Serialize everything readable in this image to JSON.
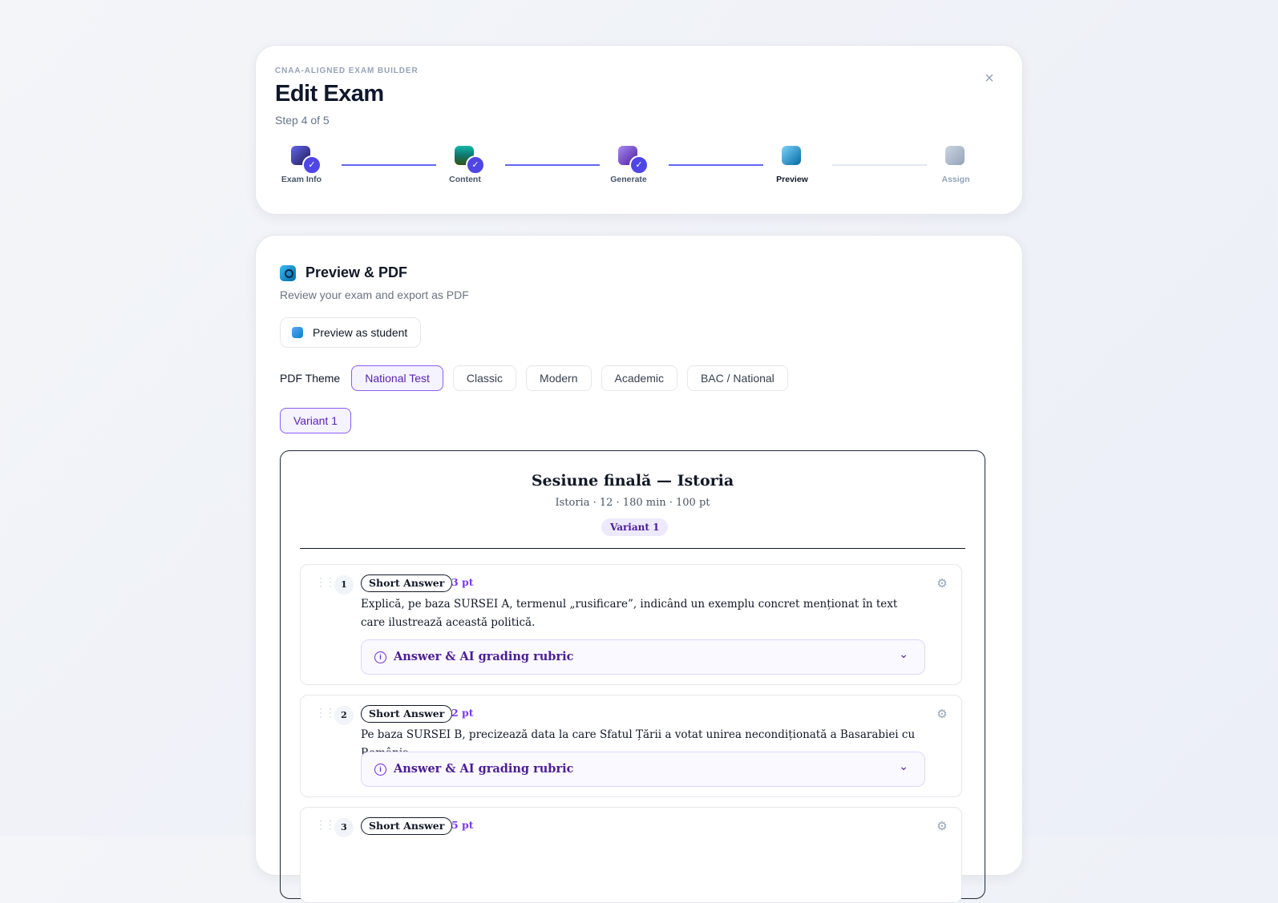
{
  "header": {
    "eyebrow": "CNAA-ALIGNED EXAM BUILDER",
    "title": "Edit Exam",
    "step_count": "Step 4 of 5",
    "close_icon": "×"
  },
  "stepper": {
    "steps": [
      {
        "label": "Exam Info",
        "state": "done",
        "icon": "clipboard-icon"
      },
      {
        "label": "Content",
        "state": "done",
        "icon": "books-icon"
      },
      {
        "label": "Generate",
        "state": "done",
        "icon": "notebook-icon"
      },
      {
        "label": "Preview",
        "state": "active",
        "icon": "magnifier-icon"
      },
      {
        "label": "Assign",
        "state": "pending",
        "icon": "send-icon"
      }
    ],
    "check_glyph": "✓"
  },
  "section": {
    "title": "Preview & PDF",
    "subtitle": "Review your exam and export as PDF",
    "preview_button": "Preview as student"
  },
  "theme": {
    "label": "PDF Theme",
    "options": [
      "National Test",
      "Classic",
      "Modern",
      "Academic",
      "BAC / National"
    ],
    "selected": "National Test"
  },
  "variants": {
    "selected": "Variant 1"
  },
  "paper": {
    "title": "Sesiune finală — Istoria",
    "meta": "Istoria · 12 · 180 min · 100 pt",
    "variant": "Variant 1",
    "questions": [
      {
        "number": "1",
        "type": "Short Answer",
        "points": "3 pt",
        "text": "Explică, pe baza SURSEI A, termenul „rusificare”, indicând un exemplu concret menționat în text care ilustrează această politică.",
        "rubric_label": "Answer & AI grading rubric"
      },
      {
        "number": "2",
        "type": "Short Answer",
        "points": "2 pt",
        "text": "Pe baza SURSEI B, precizează data la care Sfatul Țării a votat unirea necondiționată a Basarabiei cu România.",
        "rubric_label": "Answer & AI grading rubric"
      },
      {
        "number": "3",
        "type": "Short Answer",
        "points": "5 pt",
        "text": "",
        "rubric_label": ""
      }
    ]
  },
  "colors": {
    "accent": "#6366f1",
    "selected_chip_bg": "#f5f3ff",
    "selected_chip_border": "#8b5cf6",
    "points": "#7c3aed",
    "rubric_text": "#4c1d95"
  }
}
